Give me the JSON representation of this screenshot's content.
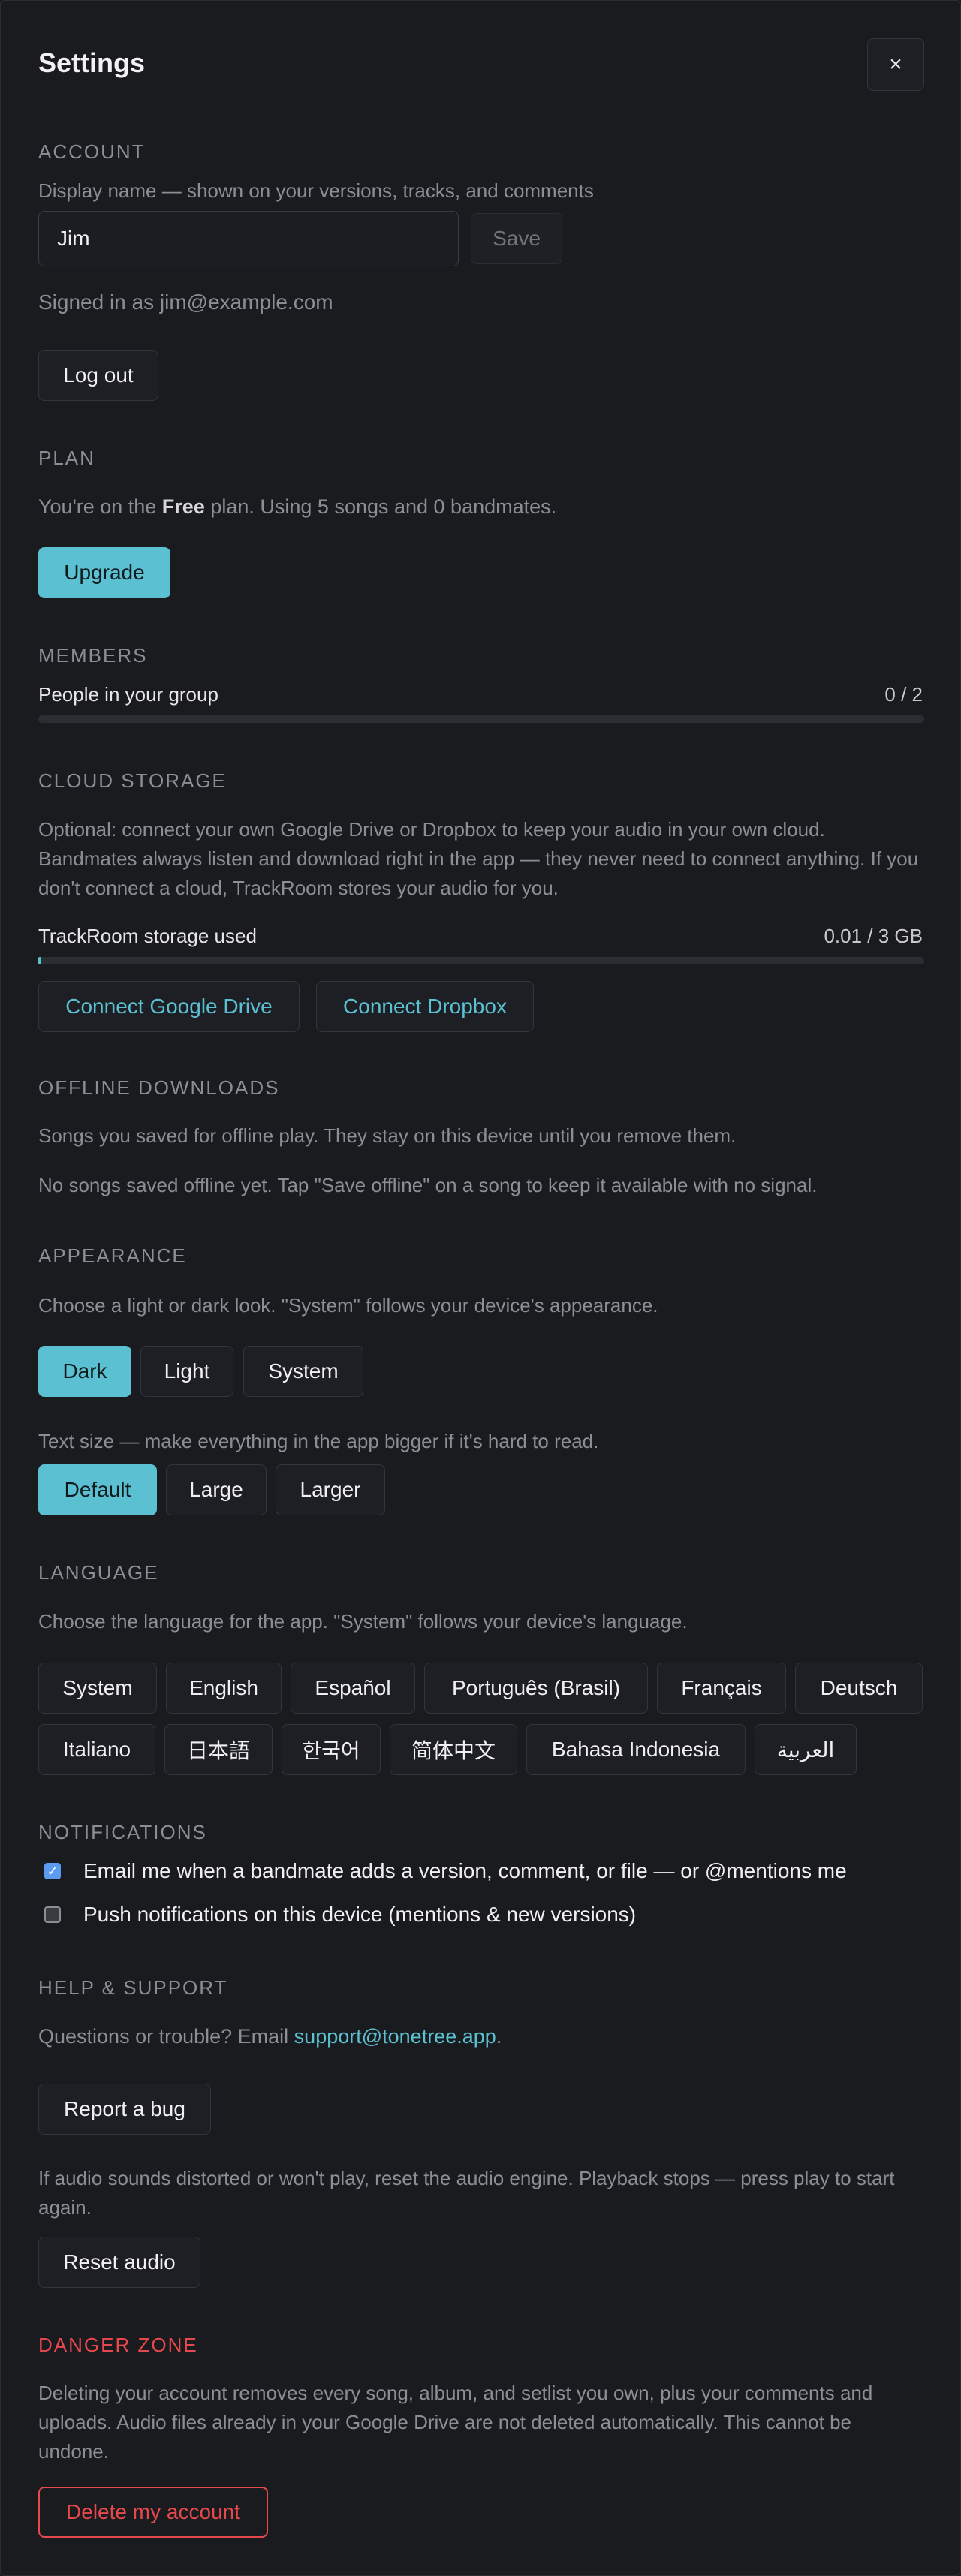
{
  "header": {
    "title": "Settings",
    "close_label": "×"
  },
  "account": {
    "label": "ACCOUNT",
    "display_name_help": "Display name — shown on your versions, tracks, and comments",
    "display_name_value": "Jim",
    "save_label": "Save",
    "signed_in_text": "Signed in as jim@example.com",
    "logout_label": "Log out"
  },
  "plan": {
    "label": "PLAN",
    "text_before": "You're on the ",
    "plan_name": "Free",
    "text_after": " plan. Using 5 songs and 0 bandmates.",
    "upgrade_label": "Upgrade"
  },
  "members": {
    "label": "MEMBERS",
    "people_label": "People in your group",
    "count_text": "0 / 2",
    "fraction": 0
  },
  "cloud": {
    "label": "CLOUD STORAGE",
    "description": "Optional: connect your own Google Drive or Dropbox to keep your audio in your own cloud. Bandmates always listen and download right in the app — they never need to connect anything. If you don't connect a cloud, TrackRoom stores your audio for you.",
    "storage_label": "TrackRoom storage used",
    "storage_value": "0.01 / 3 GB",
    "fraction": 0.0033,
    "connect_drive_label": "Connect Google Drive",
    "connect_dropbox_label": "Connect Dropbox"
  },
  "offline": {
    "label": "OFFLINE DOWNLOADS",
    "description": "Songs you saved for offline play. They stay on this device until you remove them.",
    "empty_text": "No songs saved offline yet. Tap \"Save offline\" on a song to keep it available with no signal."
  },
  "appearance": {
    "label": "APPEARANCE",
    "description": "Choose a light or dark look. \"System\" follows your device's appearance.",
    "themes": [
      "Dark",
      "Light",
      "System"
    ],
    "selected_theme": "Dark",
    "text_size_help": "Text size — make everything in the app bigger if it's hard to read.",
    "text_sizes": [
      "Default",
      "Large",
      "Larger"
    ],
    "selected_text_size": "Default"
  },
  "language": {
    "label": "LANGUAGE",
    "description": "Choose the language for the app. \"System\" follows your device's language.",
    "options": [
      "System",
      "English",
      "Español",
      "Português (Brasil)",
      "Français",
      "Deutsch",
      "Italiano",
      "日本語",
      "한국어",
      "简体中文",
      "Bahasa Indonesia",
      "العربية"
    ]
  },
  "notifications": {
    "label": "NOTIFICATIONS",
    "email_label": "Email me when a bandmate adds a version, comment, or file — or @mentions me",
    "email_checked": true,
    "push_label": "Push notifications on this device (mentions & new versions)",
    "push_checked": false
  },
  "help": {
    "label": "HELP & SUPPORT",
    "question_text": "Questions or trouble? Email ",
    "support_email": "support@tonetree.app",
    "question_end": ".",
    "report_bug_label": "Report a bug",
    "audio_help": "If audio sounds distorted or won't play, reset the audio engine. Playback stops — press play to start again.",
    "reset_audio_label": "Reset audio"
  },
  "danger": {
    "label": "DANGER ZONE",
    "description": "Deleting your account removes every song, album, and setlist you own, plus your comments and uploads. Audio files already in your Google Drive are not deleted automatically. This cannot be undone.",
    "delete_label": "Delete my account"
  },
  "colors": {
    "accent": "#5bc0d1",
    "danger": "#e5484d",
    "background": "#1a1b1f"
  }
}
